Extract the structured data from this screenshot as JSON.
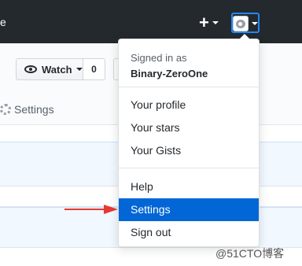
{
  "topbar": {
    "fragment": "e",
    "plus_symbol": "+"
  },
  "repohead": {
    "watch_label": "Watch",
    "watch_count": "0",
    "settings_tab": "Settings"
  },
  "dropdown": {
    "signed_in_as": "Signed in as",
    "username": "Binary-ZeroOne",
    "items": [
      {
        "label": "Your profile"
      },
      {
        "label": "Your stars"
      },
      {
        "label": "Your Gists"
      },
      {
        "label": "Help"
      },
      {
        "label": "Settings"
      },
      {
        "label": "Sign out"
      }
    ],
    "active_color": "#0366d6"
  },
  "annotation": {
    "arrow_color": "#e53935"
  },
  "watermark": "@51CTO博客"
}
